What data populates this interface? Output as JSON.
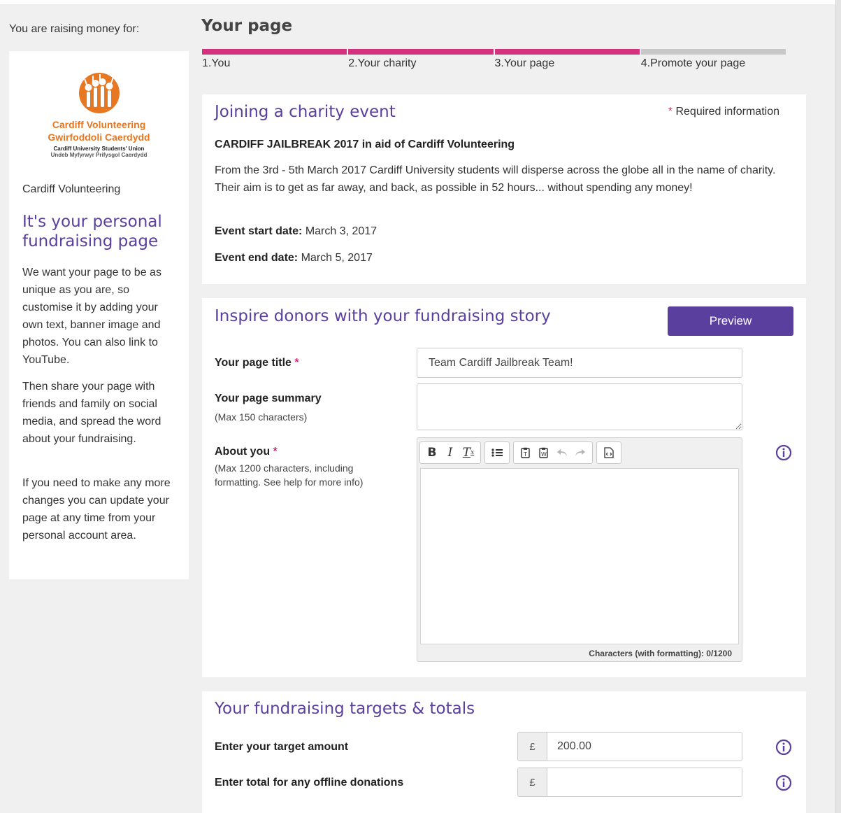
{
  "sidebar": {
    "raising_label": "You are raising money for:",
    "logo": {
      "name_line1": "Cardiff Volunteering",
      "name_line2": "Gwirfoddoli Caerdydd",
      "sub_line1": "Cardiff University Students' Union",
      "sub_line2": "Undeb Myfyrwyr Prifysgol Caerdydd",
      "color": "#e87722"
    },
    "charity_name": "Cardiff Volunteering",
    "title": "It's your personal fundraising page",
    "paragraphs": [
      "We want your page to be as unique as you are, so customise it by adding your own text, banner image and photos. You can also link to YouTube.",
      "Then share your page with friends and family on social media, and spread the word about your fundraising.",
      "If you need to make any more changes you can update your page at any time from your personal account area."
    ]
  },
  "page_heading": "Your page",
  "steps": [
    {
      "label": "1.You",
      "complete": true
    },
    {
      "label": "2.Your charity",
      "complete": true
    },
    {
      "label": "3.Your page",
      "complete": true
    },
    {
      "label": "4.Promote your page",
      "complete": false
    }
  ],
  "event_card": {
    "title": "Joining a charity event",
    "required_star": "*",
    "required_note": "Required information",
    "event_name": "CARDIFF JAILBREAK 2017 in aid of Cardiff Volunteering",
    "description": "From the 3rd - 5th March 2017 Cardiff University students will disperse across the globe all in the name of charity. Their aim is to get as far away, and back, as possible in 52 hours... without spending any money!",
    "start_label": "Event start date:",
    "start_value": "March 3, 2017",
    "end_label": "Event end date:",
    "end_value": "March 5, 2017"
  },
  "story_card": {
    "title": "Inspire donors with your fundraising story",
    "preview_label": "Preview",
    "page_title_label": "Your page title",
    "page_title_value": "Team Cardiff Jailbreak Team!",
    "summary_label": "Your page summary",
    "summary_hint": "(Max 150 characters)",
    "summary_value": "",
    "about_label": "About you",
    "about_hint": "(Max 1200 characters, including formatting. See help for more info)",
    "required_star": "*",
    "toolbar": [
      "bold-icon",
      "italic-icon",
      "clear-format-icon",
      "bullet-list-icon",
      "paste-text-icon",
      "paste-word-icon",
      "undo-icon",
      "redo-icon",
      "source-icon"
    ],
    "char_count": "Characters (with formatting): 0/1200"
  },
  "targets_card": {
    "title": "Your fundraising targets & totals",
    "target_label": "Enter your target amount",
    "target_currency": "£",
    "target_value": "200.00",
    "offline_label": "Enter total for any offline donations",
    "offline_currency": "£",
    "offline_value": ""
  },
  "colors": {
    "accent": "#5b3f9e",
    "step_active": "#d4317e",
    "step_inactive": "#c8c8c8"
  }
}
